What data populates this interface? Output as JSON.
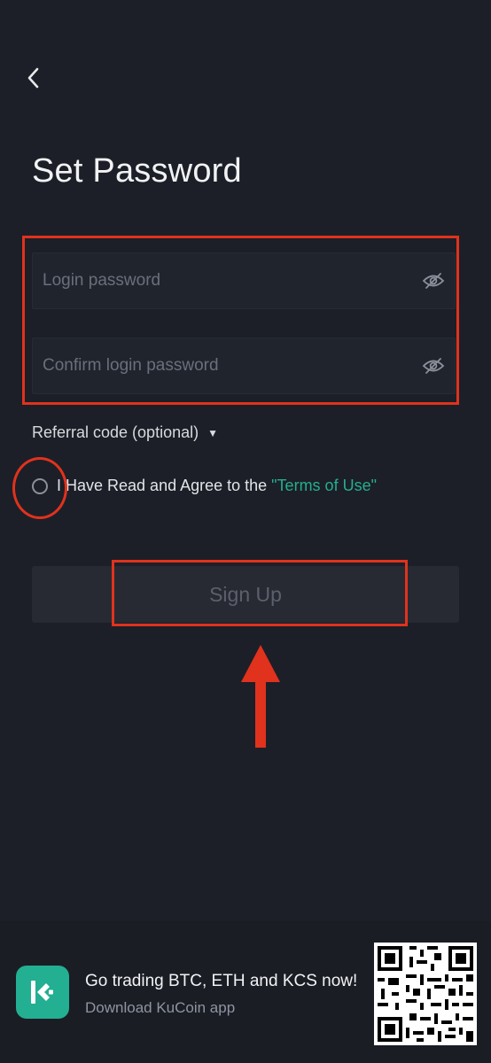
{
  "header": {
    "title": "Set Password"
  },
  "form": {
    "login_password_placeholder": "Login password",
    "confirm_password_placeholder": "Confirm login password",
    "referral_label": "Referral code (optional)",
    "agree_text": "I Have Read and Agree to the",
    "terms_link": "\"Terms of Use\"",
    "signup_label": "Sign Up"
  },
  "banner": {
    "title": "Go trading BTC, ETH and KCS now!",
    "subtitle": "Download KuCoin app"
  },
  "colors": {
    "background": "#1c1f27",
    "accent": "#24ae8f",
    "annotation": "#e0321d"
  },
  "icons": {
    "back": "chevron-left-icon",
    "eye": "eye-off-icon",
    "caret": "caret-down-icon",
    "logo": "kucoin-logo-icon"
  }
}
